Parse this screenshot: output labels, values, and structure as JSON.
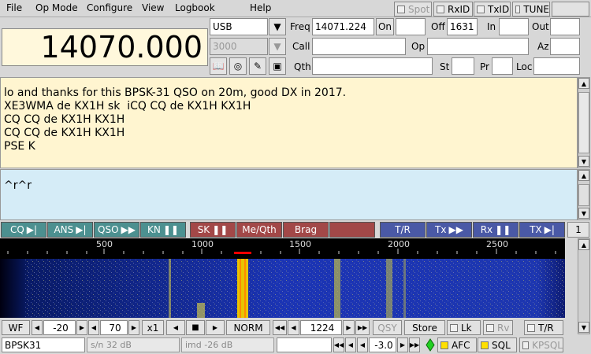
{
  "menu": {
    "items": [
      "File",
      "Op Mode",
      "Configure",
      "View",
      "Logbook",
      "Help"
    ]
  },
  "topbuttons": {
    "spot": "Spot",
    "rxid": "RxID",
    "txid": "TxID",
    "tune": "TUNE"
  },
  "frequency": "14070.000",
  "mode": "USB",
  "bandwidth": "3000",
  "fields": {
    "freq_label": "Freq",
    "freq_value": "14071.224",
    "on_label": "On",
    "off_label": "Off",
    "off_value": "1631",
    "in_label": "In",
    "out_label": "Out",
    "call_label": "Call",
    "op_label": "Op",
    "az_label": "Az",
    "qth_label": "Qth",
    "st_label": "St",
    "pr_label": "Pr",
    "loc_label": "Loc"
  },
  "rx_text": [
    "lo and thanks for this BPSK-31 QSO on 20m, good DX in 2017.",
    "XE3WMA de KX1H sk  iCQ CQ de KX1H KX1H",
    "CQ CQ de KX1H KX1H",
    "CQ CQ de KX1H KX1H",
    "PSE K"
  ],
  "tx_text": "^r^r",
  "macros": {
    "cq": "CQ",
    "ans": "ANS",
    "qso": "QSO",
    "kn": "KN",
    "sk": "SK",
    "meqth": "Me/Qth",
    "brag": "Brag",
    "blank": "",
    "tr": "T/R",
    "tx": "Tx",
    "rx": "Rx",
    "txi": "TX",
    "page": "1"
  },
  "scale_ticks": [
    "500",
    "1000",
    "1500",
    "2000",
    "2500"
  ],
  "bottom": {
    "wf": "WF",
    "minus20": "-20",
    "seventy": "70",
    "x1": "x1",
    "norm": "NORM",
    "offset": "1224",
    "qsy": "QSY",
    "store": "Store",
    "lk": "Lk",
    "rv": "Rv",
    "tr": "T/R"
  },
  "status": {
    "mode": "BPSK31",
    "sn": "s/n 32 dB",
    "imd": "imd -26 dB",
    "afc_val": "-3.0",
    "afc": "AFC",
    "sql": "SQL",
    "kpsql": "KPSQL"
  },
  "colors": {
    "teal": "#4c9090",
    "red": "#a24848",
    "blue": "#4a59a6",
    "rx_bg": "#fff5d0",
    "tx_bg": "#d5ecf7"
  }
}
